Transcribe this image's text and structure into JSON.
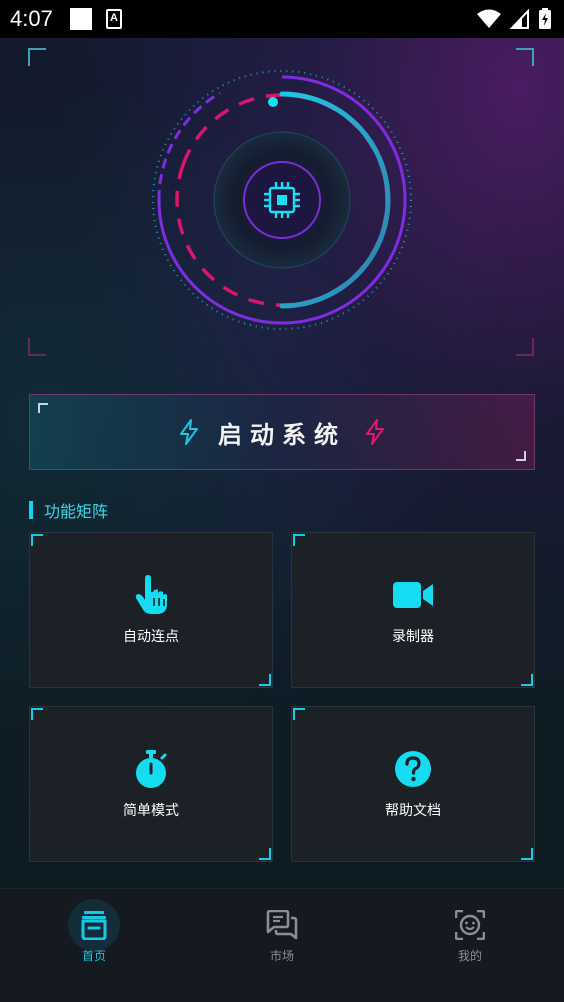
{
  "status_bar": {
    "time": "4:07",
    "notification_icons": [
      "square-notification-icon",
      "accessibility-icon"
    ],
    "system_icons": [
      "wifi-icon",
      "cellular-signal-icon",
      "battery-charging-icon"
    ]
  },
  "hero": {
    "center_icon": "cpu-chip-icon",
    "colors": {
      "cyan": "#12d4f0",
      "magenta": "#e0186e",
      "purple": "#8a2be2"
    }
  },
  "start_button": {
    "label": "启动系统",
    "left_icon": "lightning-icon",
    "right_icon": "lightning-icon",
    "left_icon_color": "#1ec6e0",
    "right_icon_color": "#e3186e"
  },
  "section": {
    "title": "功能矩阵",
    "accent_color": "#11d6ef"
  },
  "features": [
    {
      "label": "自动连点",
      "icon": "tap-hand-icon"
    },
    {
      "label": "录制器",
      "icon": "video-camera-icon"
    },
    {
      "label": "简单模式",
      "icon": "stopwatch-icon"
    },
    {
      "label": "帮助文档",
      "icon": "help-circle-icon"
    }
  ],
  "bottom_nav": {
    "items": [
      {
        "label": "首页",
        "icon": "home-box-icon",
        "active": true
      },
      {
        "label": "市场",
        "icon": "chat-bubbles-icon",
        "active": false
      },
      {
        "label": "我的",
        "icon": "face-scan-icon",
        "active": false
      }
    ],
    "active_color": "#14cbe3",
    "inactive_color": "#8a8f96"
  }
}
